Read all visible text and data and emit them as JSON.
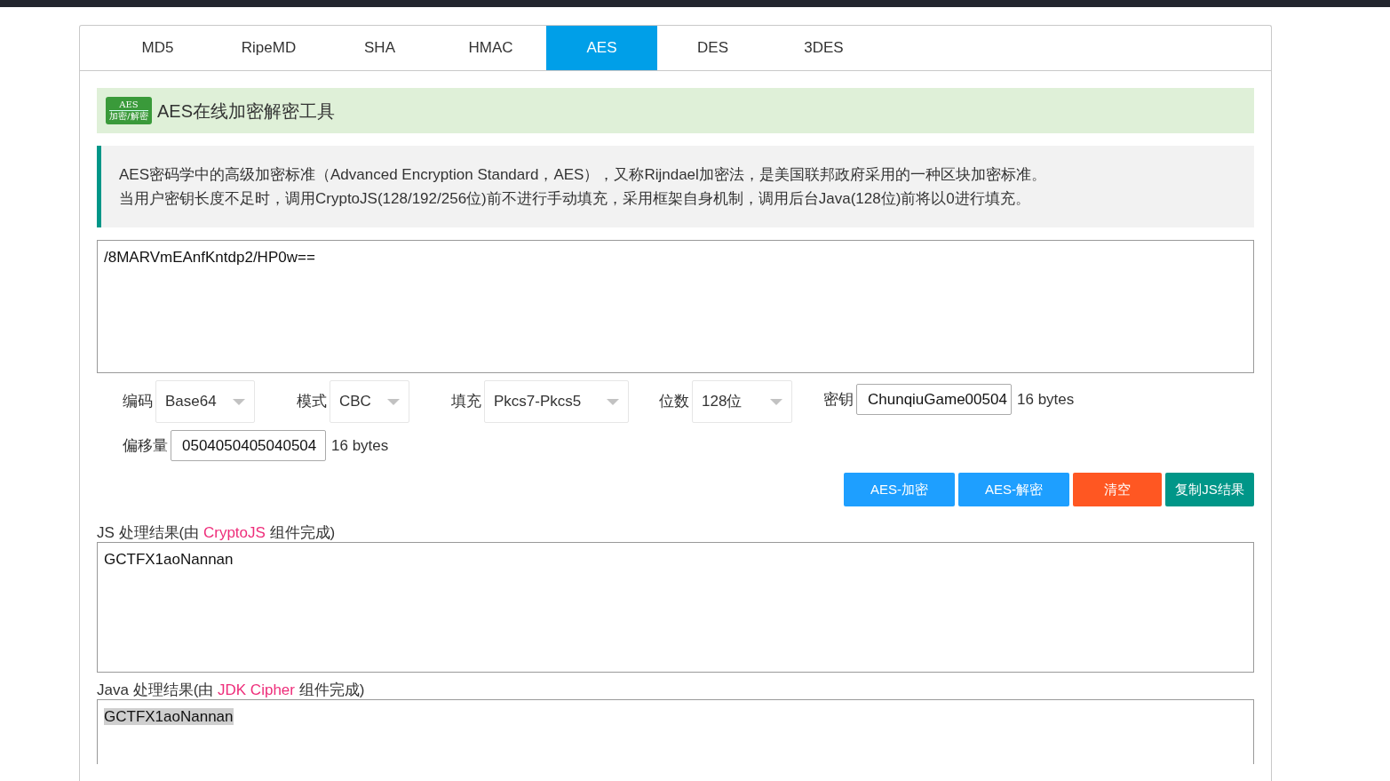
{
  "tabs": [
    {
      "label": "MD5",
      "selected": false
    },
    {
      "label": "RipeMD",
      "selected": false
    },
    {
      "label": "SHA",
      "selected": false
    },
    {
      "label": "HMAC",
      "selected": false
    },
    {
      "label": "AES",
      "selected": true
    },
    {
      "label": "DES",
      "selected": false
    },
    {
      "label": "3DES",
      "selected": false
    }
  ],
  "title": {
    "logo_top": "AES",
    "logo_bottom": "加密/解密",
    "text": "AES在线加密解密工具"
  },
  "description": [
    "AES密码学中的高级加密标准（Advanced Encryption Standard，AES），又称Rijndael加密法，是美国联邦政府采用的一种区块加密标准。",
    "当用户密钥长度不足时，调用CryptoJS(128/192/256位)前不进行手动填充，采用框架自身机制，调用后台Java(128位)前将以0进行填充。"
  ],
  "input": {
    "value": "/8MARVmEAnfKntdp2/HP0w=="
  },
  "options": [
    {
      "kind": "select",
      "label": "编码",
      "value": "Base64"
    },
    {
      "kind": "select",
      "label": "模式",
      "value": "CBC"
    },
    {
      "kind": "select",
      "label": "填充",
      "value": "Pkcs7-Pkcs5"
    },
    {
      "kind": "select",
      "label": "位数",
      "value": "128位"
    },
    {
      "kind": "text",
      "label": "密钥",
      "value": "ChunqiuGame00504",
      "note": "16 bytes"
    },
    {
      "kind": "text",
      "label": "偏移量",
      "value": "0504050405040504",
      "note": "16 bytes"
    }
  ],
  "buttons": [
    {
      "label": "AES-加密",
      "color": "#1e9fff"
    },
    {
      "label": "AES-解密",
      "color": "#1e9fff"
    },
    {
      "label": "清空",
      "color": "#ff5722"
    },
    {
      "label": "复制JS结果",
      "color": "#009688"
    }
  ],
  "results": [
    {
      "prefix": "JS 处理结果(由 ",
      "link": "CryptoJS",
      "suffix": " 组件完成)",
      "value": "GCTFX1aoNannan",
      "highlighted": false
    },
    {
      "prefix": "Java 处理结果(由 ",
      "link": "JDK Cipher",
      "suffix": " 组件完成)",
      "value": "GCTFX1aoNannan",
      "highlighted": true
    }
  ]
}
